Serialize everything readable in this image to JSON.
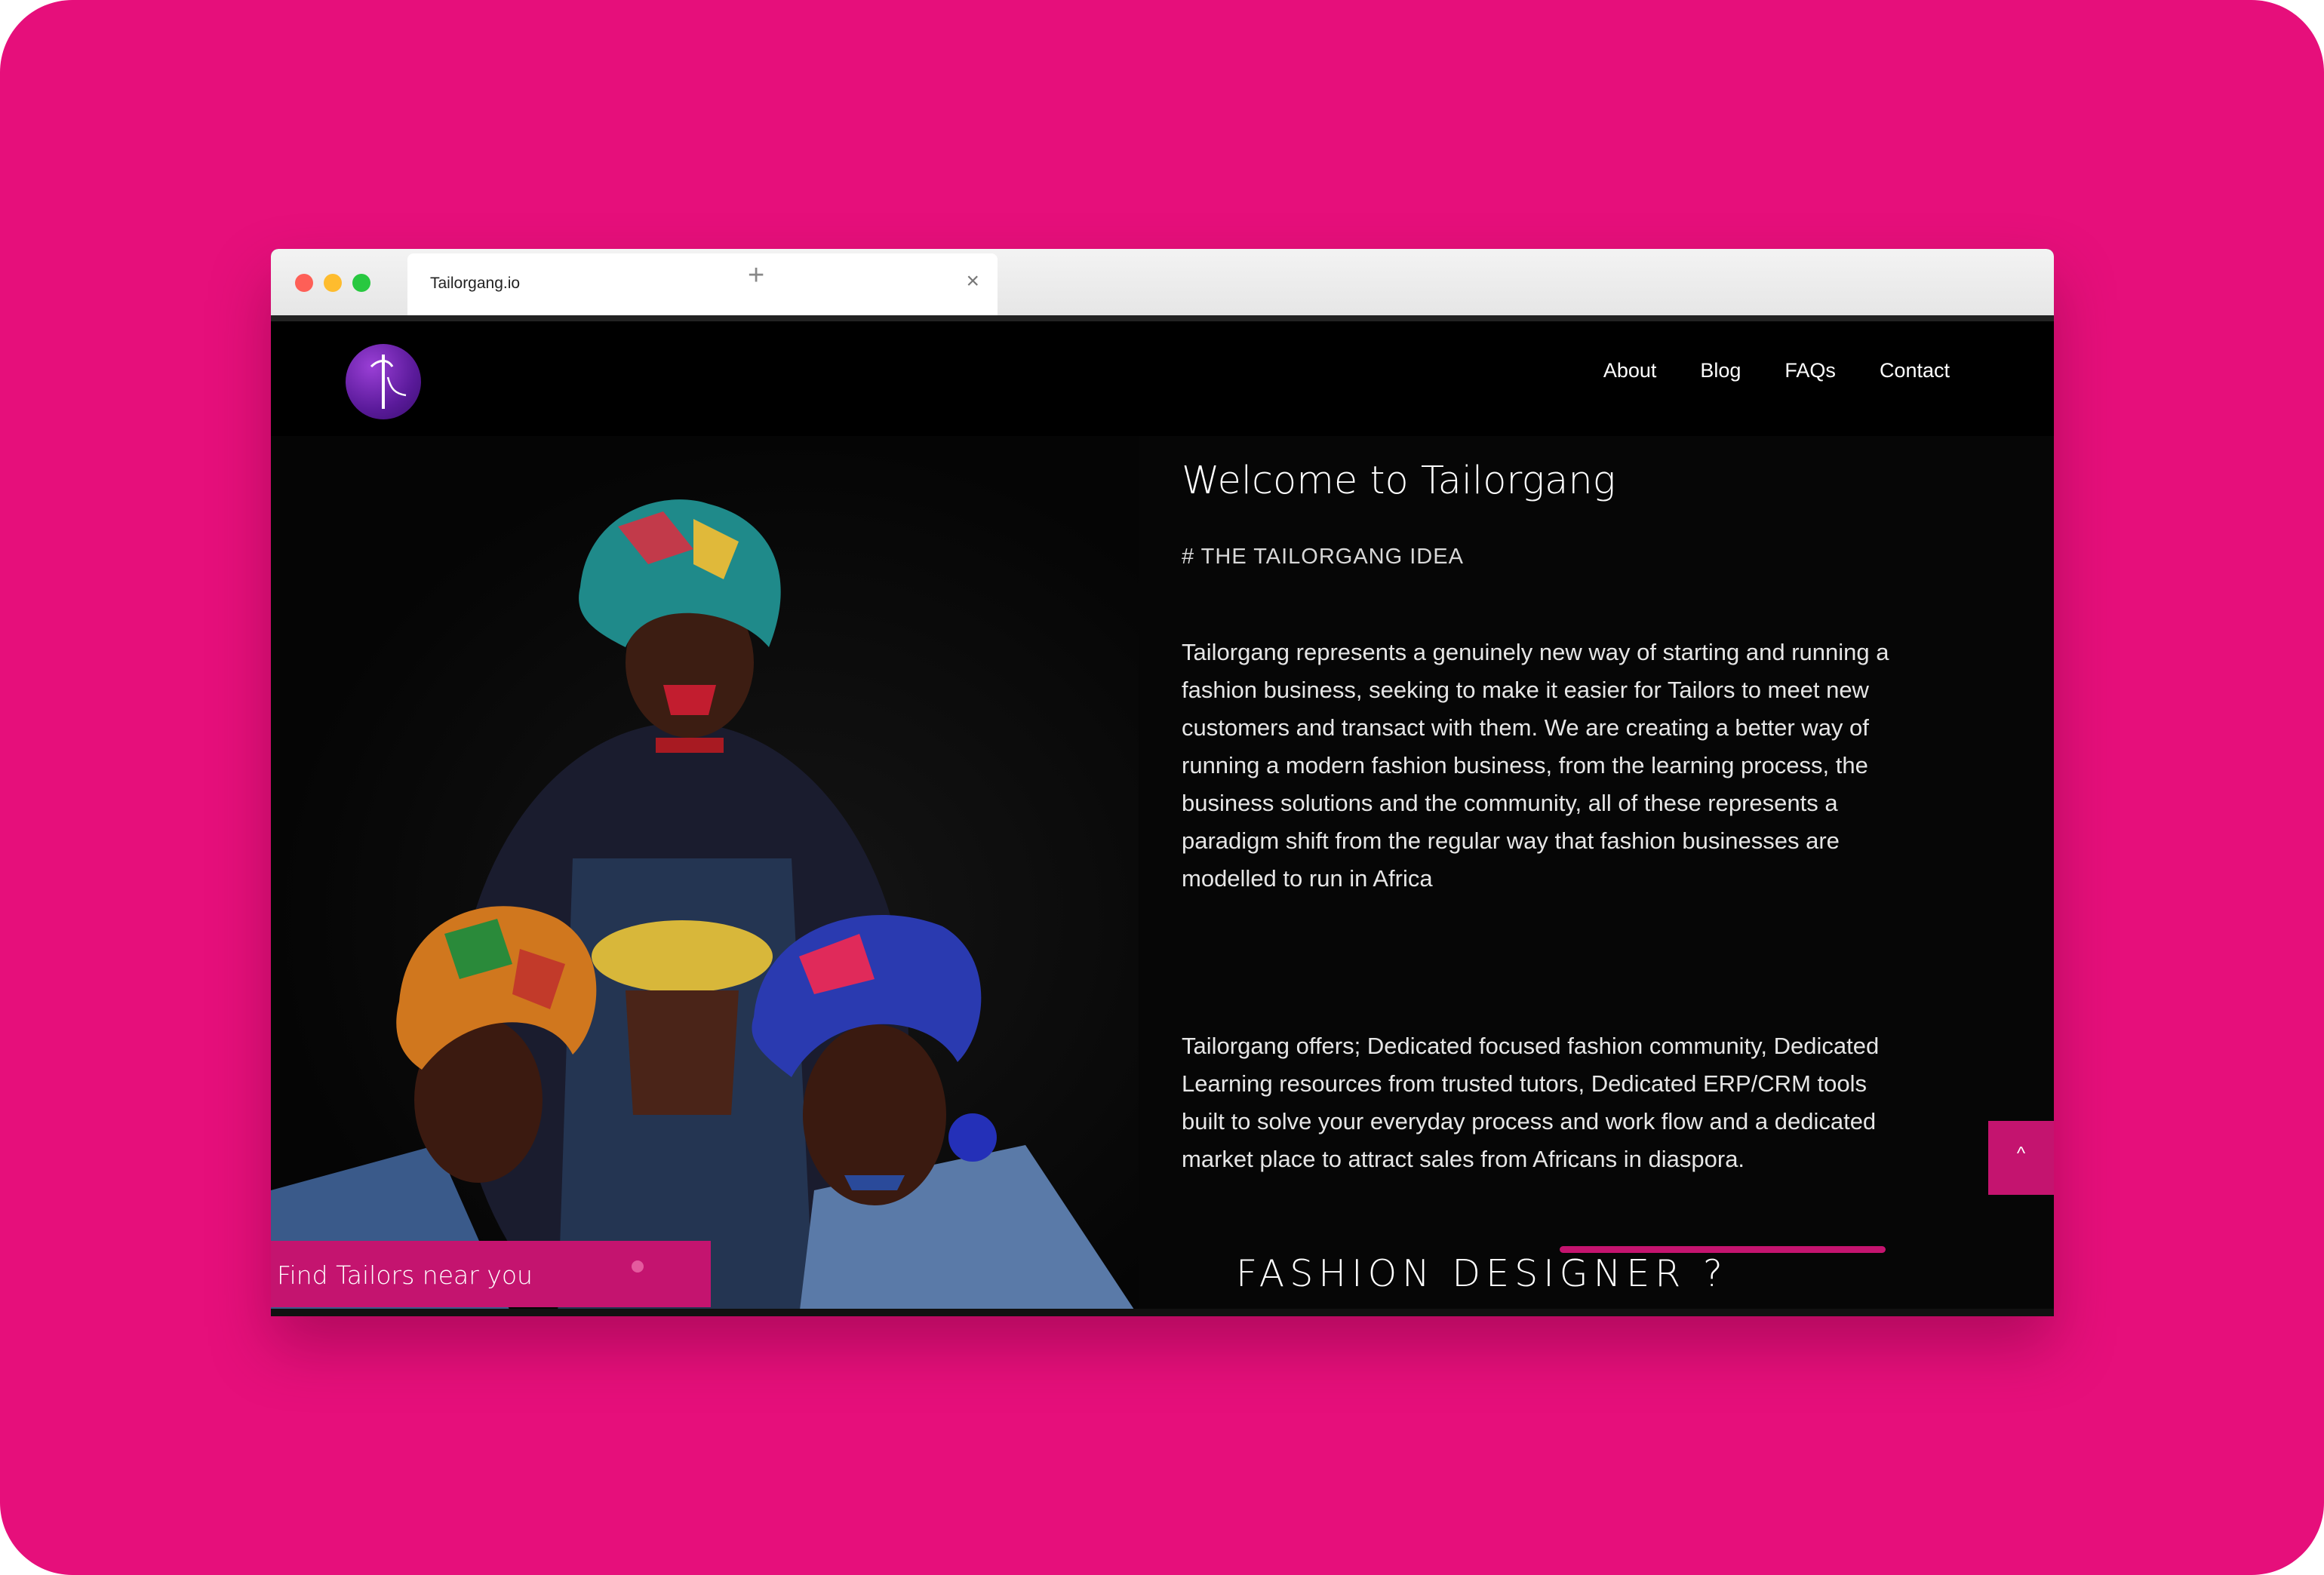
{
  "browser": {
    "tab_title": "Tailorgang.io",
    "close_icon": "×",
    "new_tab_icon": "+"
  },
  "nav": {
    "items": [
      {
        "label": "About"
      },
      {
        "label": "Blog"
      },
      {
        "label": "FAQs"
      },
      {
        "label": "Contact"
      }
    ]
  },
  "hero": {
    "cta_label": "Find Tailors near you"
  },
  "content": {
    "title": "Welcome to Tailorgang",
    "subtitle": "# THE TAILORGANG IDEA",
    "paragraph1": "Tailorgang represents a genuinely new way of starting and running a fashion business, seeking to make it easier for Tailors to meet new customers and transact with them. We are creating a better way of running a modern fashion business, from the learning process, the business solutions and the community, all of these represents a paradigm shift from the regular way that fashion businesses are modelled to run in Africa",
    "paragraph2": "Tailorgang offers; Dedicated focused fashion community, Dedicated Learning resources from trusted tutors, Dedicated ERP/CRM tools built to solve your everyday process and work flow and a dedicated market place to attract sales from Africans in diaspora.",
    "designer_heading": "FASHION DESIGNER ?"
  },
  "back_to_top": {
    "icon": "^"
  },
  "colors": {
    "brand_pink": "#e60f7b",
    "accent_pink": "#c4146f",
    "logo_purple": "#6a22a8"
  }
}
